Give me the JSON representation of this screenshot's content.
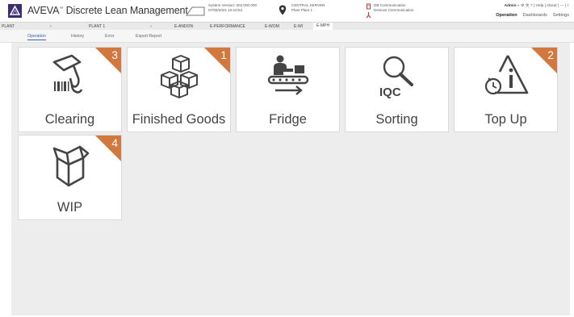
{
  "header": {
    "app_name": "AVEVA",
    "app_name_rest": "Discrete Lean Management",
    "system_version": "System Version: 002.000.000",
    "system_date": "07/06/2021 10:10:54",
    "server_name": "CENTRAL SERVER",
    "server_plant": "Plant Plant 1",
    "db_comm": "DB Communication",
    "devices_comm": "Devices Communication",
    "user": "Admin",
    "user_tools": "? | Help | About | — | ×",
    "main_nav": [
      {
        "label": "Operation",
        "active": true
      },
      {
        "label": "Dashboards",
        "active": false
      },
      {
        "label": "Settings",
        "active": false
      }
    ]
  },
  "navbar": {
    "plant_label": "PLANT",
    "plant_value": "PLANT 1",
    "modules": [
      {
        "label": "E-ANDON",
        "active": false
      },
      {
        "label": "E-PERFORMANCE",
        "active": false
      },
      {
        "label": "E-WOM",
        "active": false
      },
      {
        "label": "E-WI",
        "active": false
      },
      {
        "label": "E-MPH",
        "active": true
      }
    ]
  },
  "subtabs": [
    {
      "label": "Operation",
      "active": true
    },
    {
      "label": "History",
      "active": false
    },
    {
      "label": "Error",
      "active": false
    },
    {
      "label": "Export Report",
      "active": false
    }
  ],
  "tiles": [
    {
      "label": "Clearing",
      "badge": "3",
      "icon": "barcode-scanner-icon"
    },
    {
      "label": "Finished Goods",
      "badge": "1",
      "icon": "boxes-icon"
    },
    {
      "label": "Fridge",
      "badge": "",
      "icon": "conveyor-worker-icon"
    },
    {
      "label": "Sorting",
      "badge": "",
      "icon": "iqc-magnifier-icon",
      "icon_text": "IQC"
    },
    {
      "label": "Top Up",
      "badge": "2",
      "icon": "timer-alert-icon"
    },
    {
      "label": "WIP",
      "badge": "4",
      "icon": "open-box-icon"
    }
  ],
  "colors": {
    "badge": "#d2773d",
    "logo": "#3c2d73",
    "active_tab": "#3a5ea8",
    "content_bg": "#ededed"
  }
}
